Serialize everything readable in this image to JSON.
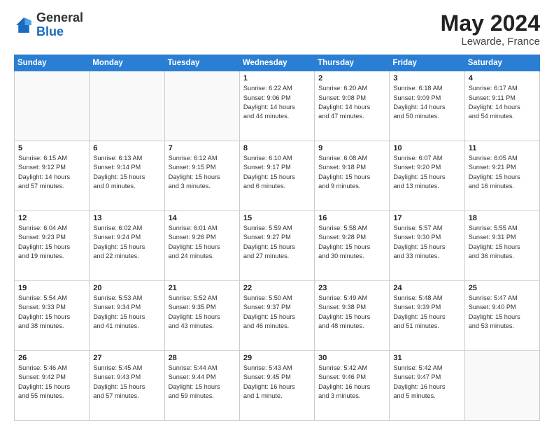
{
  "header": {
    "logo_general": "General",
    "logo_blue": "Blue",
    "month": "May 2024",
    "location": "Lewarde, France"
  },
  "weekdays": [
    "Sunday",
    "Monday",
    "Tuesday",
    "Wednesday",
    "Thursday",
    "Friday",
    "Saturday"
  ],
  "weeks": [
    [
      {
        "day": "",
        "info": ""
      },
      {
        "day": "",
        "info": ""
      },
      {
        "day": "",
        "info": ""
      },
      {
        "day": "1",
        "info": "Sunrise: 6:22 AM\nSunset: 9:06 PM\nDaylight: 14 hours\nand 44 minutes."
      },
      {
        "day": "2",
        "info": "Sunrise: 6:20 AM\nSunset: 9:08 PM\nDaylight: 14 hours\nand 47 minutes."
      },
      {
        "day": "3",
        "info": "Sunrise: 6:18 AM\nSunset: 9:09 PM\nDaylight: 14 hours\nand 50 minutes."
      },
      {
        "day": "4",
        "info": "Sunrise: 6:17 AM\nSunset: 9:11 PM\nDaylight: 14 hours\nand 54 minutes."
      }
    ],
    [
      {
        "day": "5",
        "info": "Sunrise: 6:15 AM\nSunset: 9:12 PM\nDaylight: 14 hours\nand 57 minutes."
      },
      {
        "day": "6",
        "info": "Sunrise: 6:13 AM\nSunset: 9:14 PM\nDaylight: 15 hours\nand 0 minutes."
      },
      {
        "day": "7",
        "info": "Sunrise: 6:12 AM\nSunset: 9:15 PM\nDaylight: 15 hours\nand 3 minutes."
      },
      {
        "day": "8",
        "info": "Sunrise: 6:10 AM\nSunset: 9:17 PM\nDaylight: 15 hours\nand 6 minutes."
      },
      {
        "day": "9",
        "info": "Sunrise: 6:08 AM\nSunset: 9:18 PM\nDaylight: 15 hours\nand 9 minutes."
      },
      {
        "day": "10",
        "info": "Sunrise: 6:07 AM\nSunset: 9:20 PM\nDaylight: 15 hours\nand 13 minutes."
      },
      {
        "day": "11",
        "info": "Sunrise: 6:05 AM\nSunset: 9:21 PM\nDaylight: 15 hours\nand 16 minutes."
      }
    ],
    [
      {
        "day": "12",
        "info": "Sunrise: 6:04 AM\nSunset: 9:23 PM\nDaylight: 15 hours\nand 19 minutes."
      },
      {
        "day": "13",
        "info": "Sunrise: 6:02 AM\nSunset: 9:24 PM\nDaylight: 15 hours\nand 22 minutes."
      },
      {
        "day": "14",
        "info": "Sunrise: 6:01 AM\nSunset: 9:26 PM\nDaylight: 15 hours\nand 24 minutes."
      },
      {
        "day": "15",
        "info": "Sunrise: 5:59 AM\nSunset: 9:27 PM\nDaylight: 15 hours\nand 27 minutes."
      },
      {
        "day": "16",
        "info": "Sunrise: 5:58 AM\nSunset: 9:28 PM\nDaylight: 15 hours\nand 30 minutes."
      },
      {
        "day": "17",
        "info": "Sunrise: 5:57 AM\nSunset: 9:30 PM\nDaylight: 15 hours\nand 33 minutes."
      },
      {
        "day": "18",
        "info": "Sunrise: 5:55 AM\nSunset: 9:31 PM\nDaylight: 15 hours\nand 36 minutes."
      }
    ],
    [
      {
        "day": "19",
        "info": "Sunrise: 5:54 AM\nSunset: 9:33 PM\nDaylight: 15 hours\nand 38 minutes."
      },
      {
        "day": "20",
        "info": "Sunrise: 5:53 AM\nSunset: 9:34 PM\nDaylight: 15 hours\nand 41 minutes."
      },
      {
        "day": "21",
        "info": "Sunrise: 5:52 AM\nSunset: 9:35 PM\nDaylight: 15 hours\nand 43 minutes."
      },
      {
        "day": "22",
        "info": "Sunrise: 5:50 AM\nSunset: 9:37 PM\nDaylight: 15 hours\nand 46 minutes."
      },
      {
        "day": "23",
        "info": "Sunrise: 5:49 AM\nSunset: 9:38 PM\nDaylight: 15 hours\nand 48 minutes."
      },
      {
        "day": "24",
        "info": "Sunrise: 5:48 AM\nSunset: 9:39 PM\nDaylight: 15 hours\nand 51 minutes."
      },
      {
        "day": "25",
        "info": "Sunrise: 5:47 AM\nSunset: 9:40 PM\nDaylight: 15 hours\nand 53 minutes."
      }
    ],
    [
      {
        "day": "26",
        "info": "Sunrise: 5:46 AM\nSunset: 9:42 PM\nDaylight: 15 hours\nand 55 minutes."
      },
      {
        "day": "27",
        "info": "Sunrise: 5:45 AM\nSunset: 9:43 PM\nDaylight: 15 hours\nand 57 minutes."
      },
      {
        "day": "28",
        "info": "Sunrise: 5:44 AM\nSunset: 9:44 PM\nDaylight: 15 hours\nand 59 minutes."
      },
      {
        "day": "29",
        "info": "Sunrise: 5:43 AM\nSunset: 9:45 PM\nDaylight: 16 hours\nand 1 minute."
      },
      {
        "day": "30",
        "info": "Sunrise: 5:42 AM\nSunset: 9:46 PM\nDaylight: 16 hours\nand 3 minutes."
      },
      {
        "day": "31",
        "info": "Sunrise: 5:42 AM\nSunset: 9:47 PM\nDaylight: 16 hours\nand 5 minutes."
      },
      {
        "day": "",
        "info": ""
      }
    ]
  ]
}
